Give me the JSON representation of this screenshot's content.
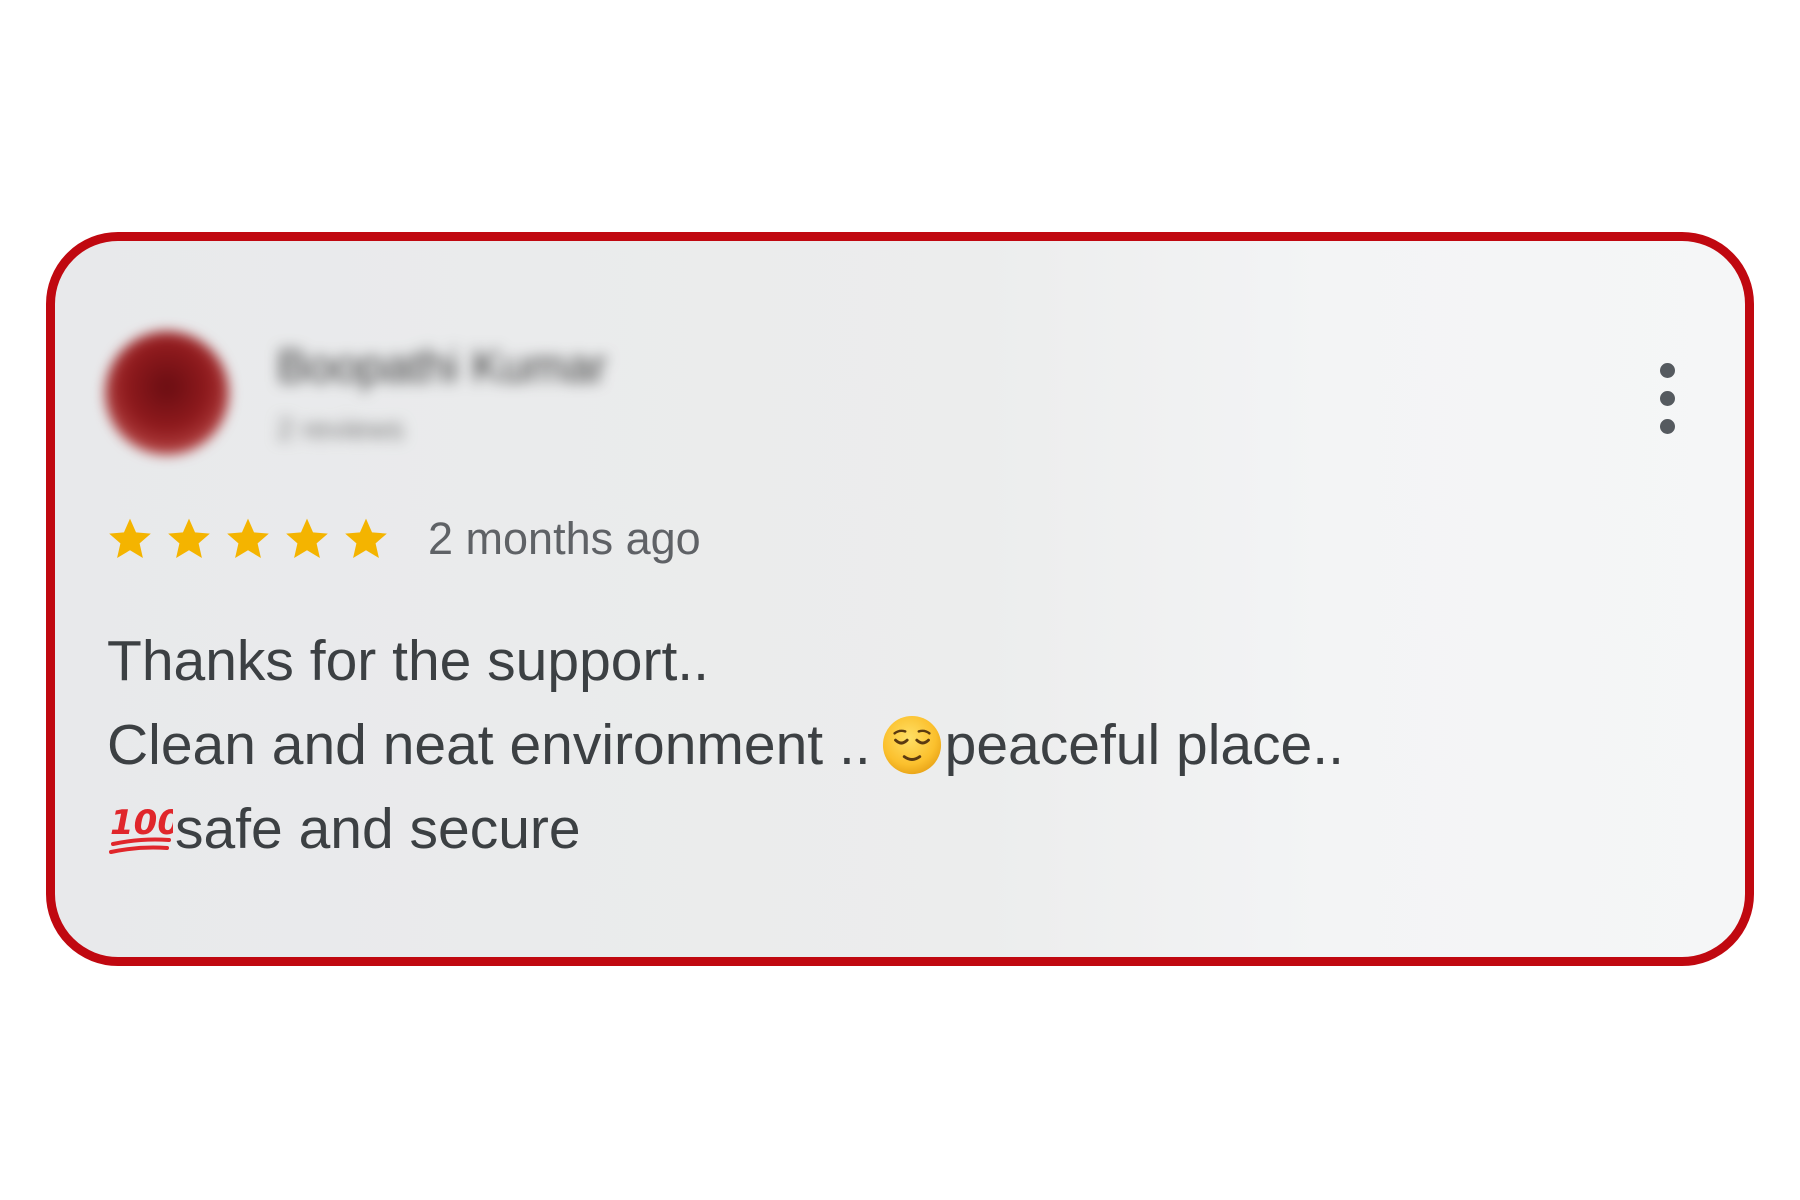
{
  "review": {
    "reviewer_name": "Boopathi Kumar",
    "reviewer_meta": "2 reviews",
    "rating": 5,
    "rating_max": 5,
    "time_ago": "2 months ago",
    "text_lines": {
      "line1": "Thanks for the support..",
      "line2_start": "Clean and neat environment ..",
      "line2_end": "peaceful place..",
      "line3": "safe and secure"
    },
    "emojis": [
      "relieved-face",
      "hundred-points"
    ]
  },
  "colors": {
    "card_border": "#c00810",
    "star": "#f4b400",
    "text": "#3c4043",
    "muted_text": "#5f6266"
  },
  "icons": {
    "more_menu": "vertical-ellipsis-icon",
    "star": "star-icon"
  }
}
